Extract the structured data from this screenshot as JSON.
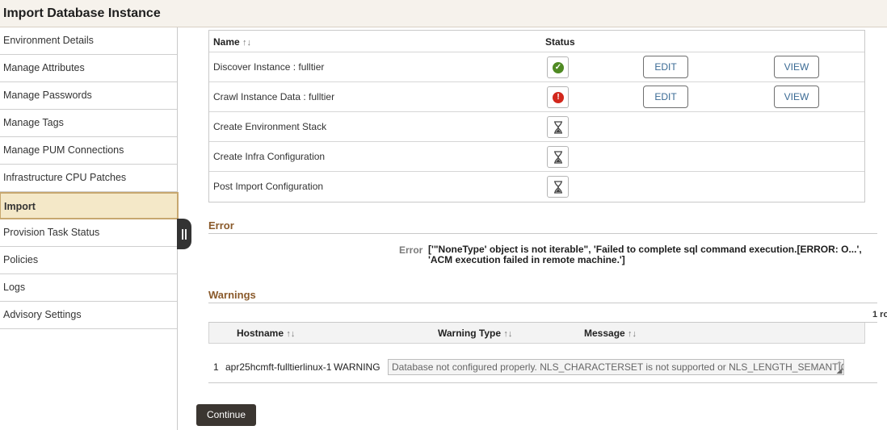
{
  "header": {
    "title": "Import Database Instance"
  },
  "sidebar": {
    "items": [
      {
        "label": "Environment Details"
      },
      {
        "label": "Manage Attributes"
      },
      {
        "label": "Manage Passwords"
      },
      {
        "label": "Manage Tags"
      },
      {
        "label": "Manage PUM Connections"
      },
      {
        "label": "Infrastructure CPU Patches"
      },
      {
        "label": "Import",
        "active": true
      },
      {
        "label": "Provision Task Status"
      },
      {
        "label": "Policies"
      },
      {
        "label": "Logs"
      },
      {
        "label": "Advisory Settings"
      }
    ],
    "collapse_handle": "||"
  },
  "steps": {
    "columns": {
      "name": "Name",
      "status": "Status",
      "sort_glyph": "↑↓"
    },
    "rows": [
      {
        "name": "Discover Instance : fulltier",
        "status": "success",
        "edit_label": "EDIT",
        "view_label": "VIEW"
      },
      {
        "name": "Crawl Instance Data : fulltier",
        "status": "error",
        "edit_label": "EDIT",
        "view_label": "VIEW"
      },
      {
        "name": "Create Environment Stack",
        "status": "pending"
      },
      {
        "name": "Create Infra Configuration",
        "status": "pending"
      },
      {
        "name": "Post Import Configuration",
        "status": "pending"
      }
    ]
  },
  "error_section": {
    "title": "Error",
    "label": "Error",
    "message": "['\"NoneType' object is not iterable\", 'Failed to complete sql command execution.[ERROR: O...', 'ACM execution failed in remote machine.']"
  },
  "warnings_section": {
    "title": "Warnings",
    "row_count": "1 ro",
    "columns": {
      "hostname": "Hostname",
      "warning_type": "Warning Type",
      "message": "Message"
    },
    "rows": [
      {
        "num": "1",
        "hostname": "apr25hcmft-fulltierlinux-1",
        "warning_type": "WARNING",
        "message": "Database not configured properly. NLS_CHARACTERSET is not supported or NLS_LENGTH_SEMANTICS"
      }
    ]
  },
  "footer": {
    "continue_label": "Continue"
  },
  "colors": {
    "accent": "#8a5a2b",
    "active_nav_bg": "#f4e8c8",
    "success": "#4f8a23",
    "error": "#d2271c",
    "button_dark": "#3b3631"
  },
  "icons": {
    "success": "check-circle-icon",
    "error": "exclamation-circle-icon",
    "pending": "hourglass-icon",
    "sort": "sort-icon",
    "expand": "expand-icon"
  }
}
